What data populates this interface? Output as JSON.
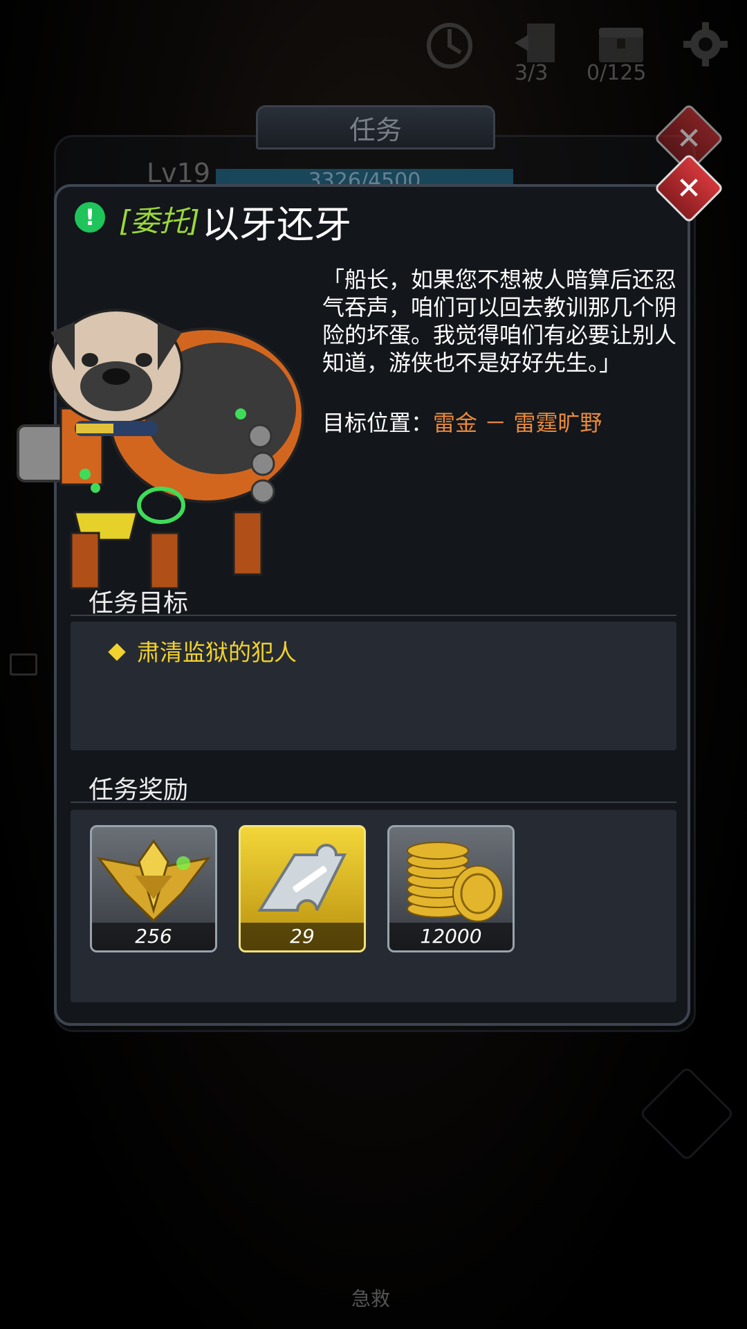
{
  "hud": {
    "refresh_icon": "refresh-icon",
    "door_icon": "door-icon",
    "door_count": "3/3",
    "chest_icon": "chest-icon",
    "chest_count": "0/125",
    "settings_icon": "gear-icon"
  },
  "background_panel": {
    "tab_title": "任务",
    "level": "Lv19",
    "exp": "3326/4500"
  },
  "quest": {
    "tag": "[委托]",
    "title": "以牙还牙",
    "description": "「船长，如果您不想被人暗算后还忍气吞声，咱们可以回去教训那几个阴险的坏蛋。我觉得咱们有必要让别人知道，游侠也不是好好先生。」",
    "target_label": "目标位置：",
    "target_location": "雷金 － 雷霆旷野"
  },
  "objectives": {
    "title": "任务目标",
    "items": [
      "肃清监狱的犯人"
    ]
  },
  "rewards": {
    "title": "任务奖励",
    "items": [
      {
        "icon": "rank-emblem-icon",
        "qty": "256"
      },
      {
        "icon": "shotgun-puzzle-piece-icon",
        "qty": "29"
      },
      {
        "icon": "gold-coins-icon",
        "qty": "12000"
      }
    ]
  },
  "bottom": {
    "label": "急救"
  },
  "colors": {
    "tag_green": "#9bd83a",
    "objective_yellow": "#f2d22c",
    "location_orange": "#e98a3a",
    "close_red": "#d2373b"
  }
}
